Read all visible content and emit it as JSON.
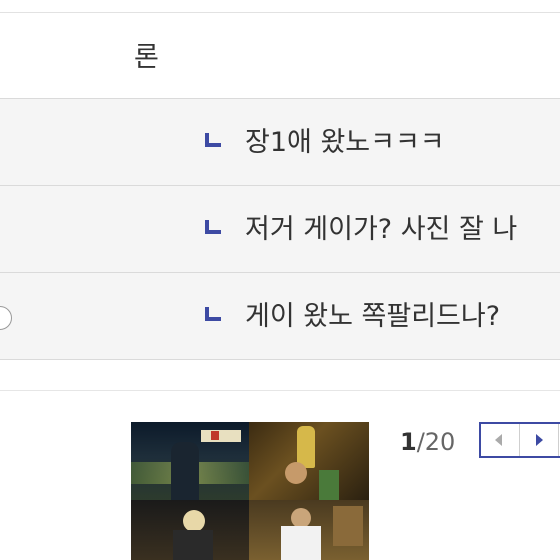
{
  "header": {
    "partial_title": "론"
  },
  "replies": [
    {
      "text": "장1애 왔노ㅋㅋㅋ"
    },
    {
      "text": "저거 게이가? 사진 잘 나"
    },
    {
      "text": "게이 왔노 쪽팔리드나?"
    }
  ],
  "gallery": {
    "current": "1",
    "total": "/20",
    "accent": "#3d4aa3"
  },
  "icons": {
    "reply": "reply-arrow-icon",
    "prev": "prev-arrow-icon",
    "next": "next-arrow-icon"
  }
}
